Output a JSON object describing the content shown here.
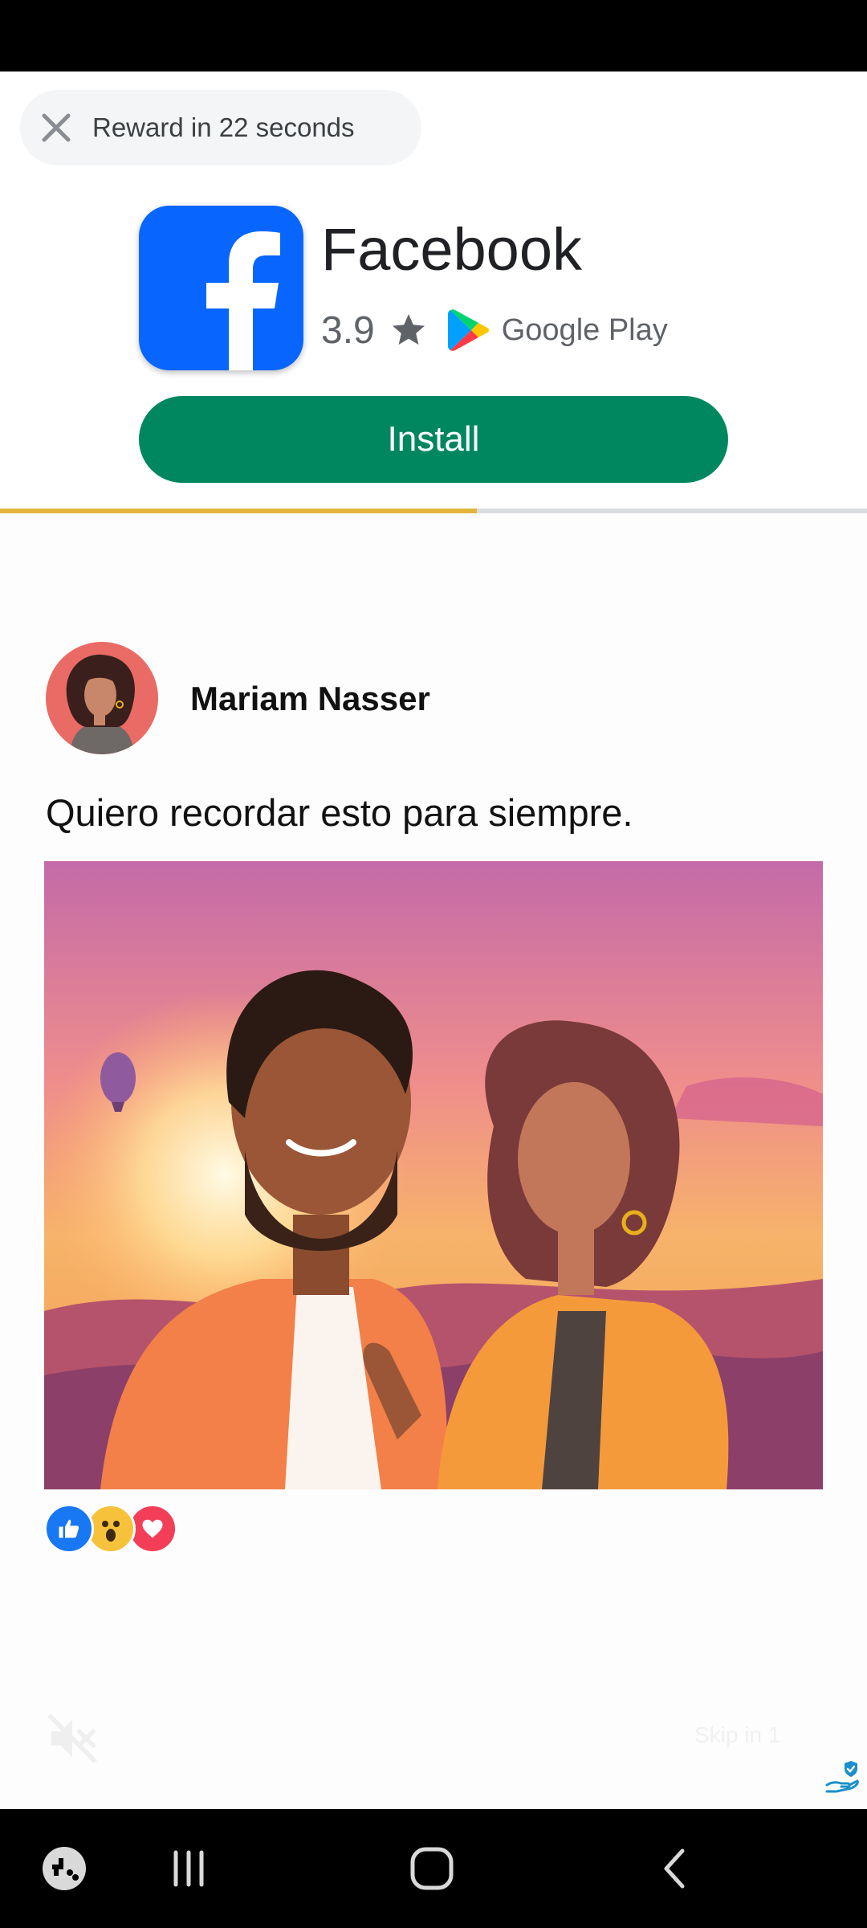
{
  "ad": {
    "reward_text": "Reward in 22 seconds",
    "reward_progress": 0.55,
    "app_name": "Facebook",
    "rating": "3.9",
    "store": "Google Play",
    "install_label": "Install",
    "icon": "facebook-logo"
  },
  "post": {
    "author": "Mariam Nasser",
    "caption": "Quiero recordar esto para siempre.",
    "reactions": [
      "like",
      "wow",
      "love"
    ]
  },
  "overlay": {
    "mute_icon": "speaker-muted-icon",
    "faint_label": "Skip in 1",
    "adchoices_icon": "adchoices-icon"
  },
  "colors": {
    "install": "#01875f",
    "facebook_blue": "#0866ff",
    "progress": "#e2b53b"
  },
  "nav_icons": [
    "game-launcher-icon",
    "recents-icon",
    "home-icon",
    "back-icon"
  ]
}
